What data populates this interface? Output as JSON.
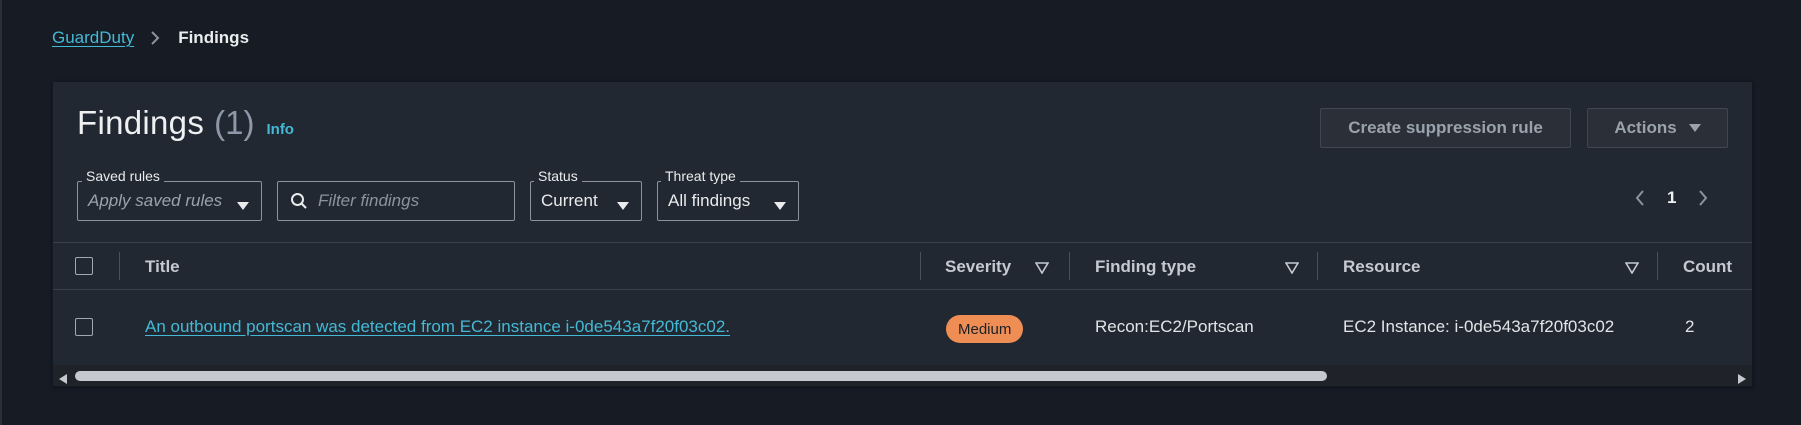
{
  "breadcrumb": {
    "parent": "GuardDuty",
    "current": "Findings"
  },
  "header": {
    "title": "Findings",
    "count": "(1)",
    "info": "Info",
    "create_suppression_rule": "Create suppression rule",
    "actions": "Actions"
  },
  "filters": {
    "saved_rules_label": "Saved rules",
    "saved_rules_value": "Apply saved rules",
    "search_placeholder": "Filter findings",
    "status_label": "Status",
    "status_value": "Current",
    "threat_type_label": "Threat type",
    "threat_type_value": "All findings"
  },
  "pagination": {
    "current_page": "1"
  },
  "table": {
    "columns": [
      "Title",
      "Severity",
      "Finding type",
      "Resource",
      "Count"
    ],
    "rows": [
      {
        "title": "An outbound portscan was detected from EC2 instance i-0de543a7f20f03c02.",
        "severity": "Medium",
        "finding_type": "Recon:EC2/Portscan",
        "resource": "EC2 Instance: i-0de543a7f20f03c02",
        "count": "2"
      }
    ]
  },
  "colors": {
    "background": "#161b24",
    "panel": "#222831",
    "link": "#44b9d6",
    "severity_medium": "#ee8e54"
  }
}
